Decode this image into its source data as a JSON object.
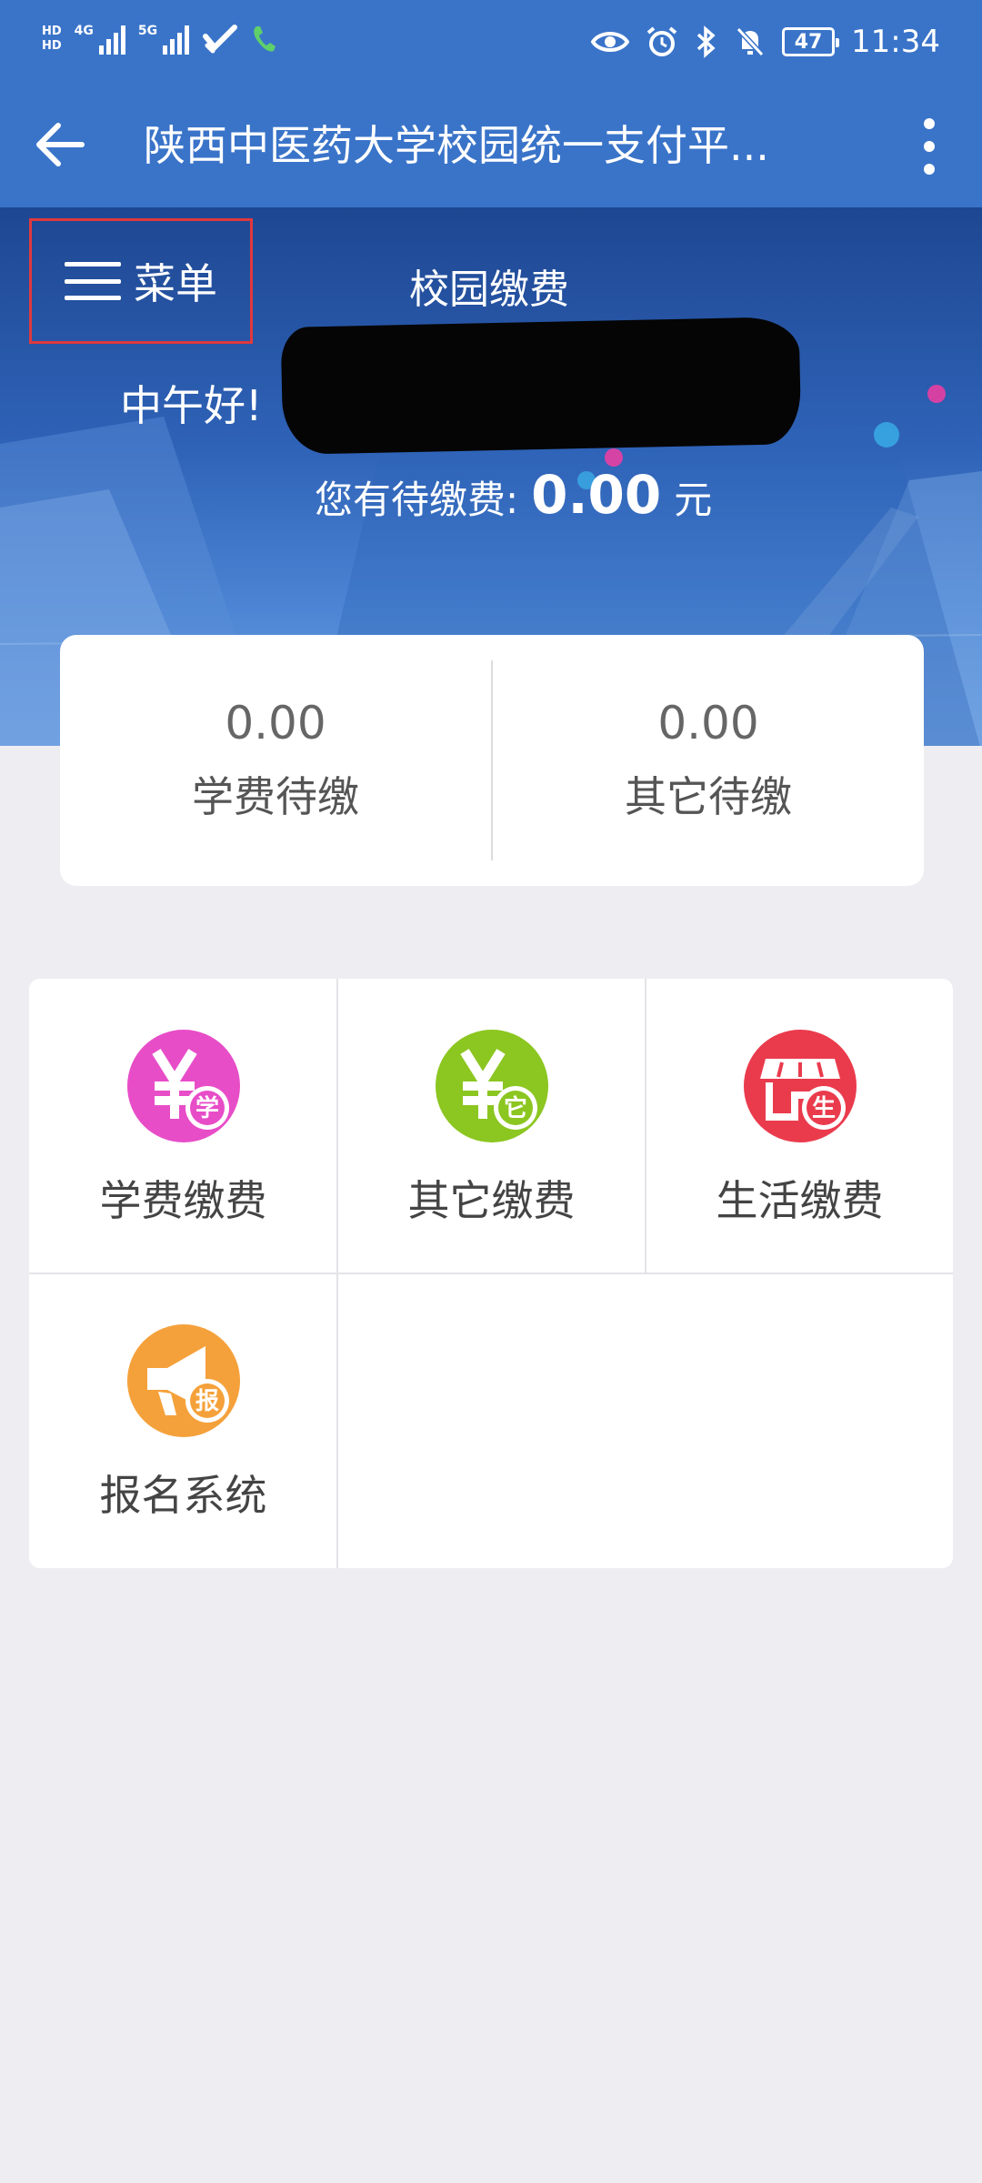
{
  "status_bar": {
    "hd_top": "HD",
    "hd_bottom": "HD",
    "net1": "4G",
    "net2": "5G",
    "battery": "47",
    "time": "11:34"
  },
  "app_bar": {
    "title": "陕西中医药大学校园统一支付平..."
  },
  "banner": {
    "menu_label": "菜单",
    "title": "校园缴费",
    "greeting": "中午好!",
    "due_label": "您有待缴费:",
    "due_amount": "0.00",
    "due_unit": "元"
  },
  "summary": [
    {
      "value": "0.00",
      "label": "学费待缴"
    },
    {
      "value": "0.00",
      "label": "其它待缴"
    }
  ],
  "services": [
    {
      "label": "学费缴费",
      "badge": "学",
      "color": "#e84dc8",
      "icon": "yuan-icon"
    },
    {
      "label": "其它缴费",
      "badge": "它",
      "color": "#8cc621",
      "icon": "yuan-icon"
    },
    {
      "label": "生活缴费",
      "badge": "生",
      "color": "#ea3b4d",
      "icon": "shop-icon"
    },
    {
      "label": "报名系统",
      "badge": "报",
      "color": "#f5a13b",
      "icon": "megaphone-icon"
    }
  ]
}
